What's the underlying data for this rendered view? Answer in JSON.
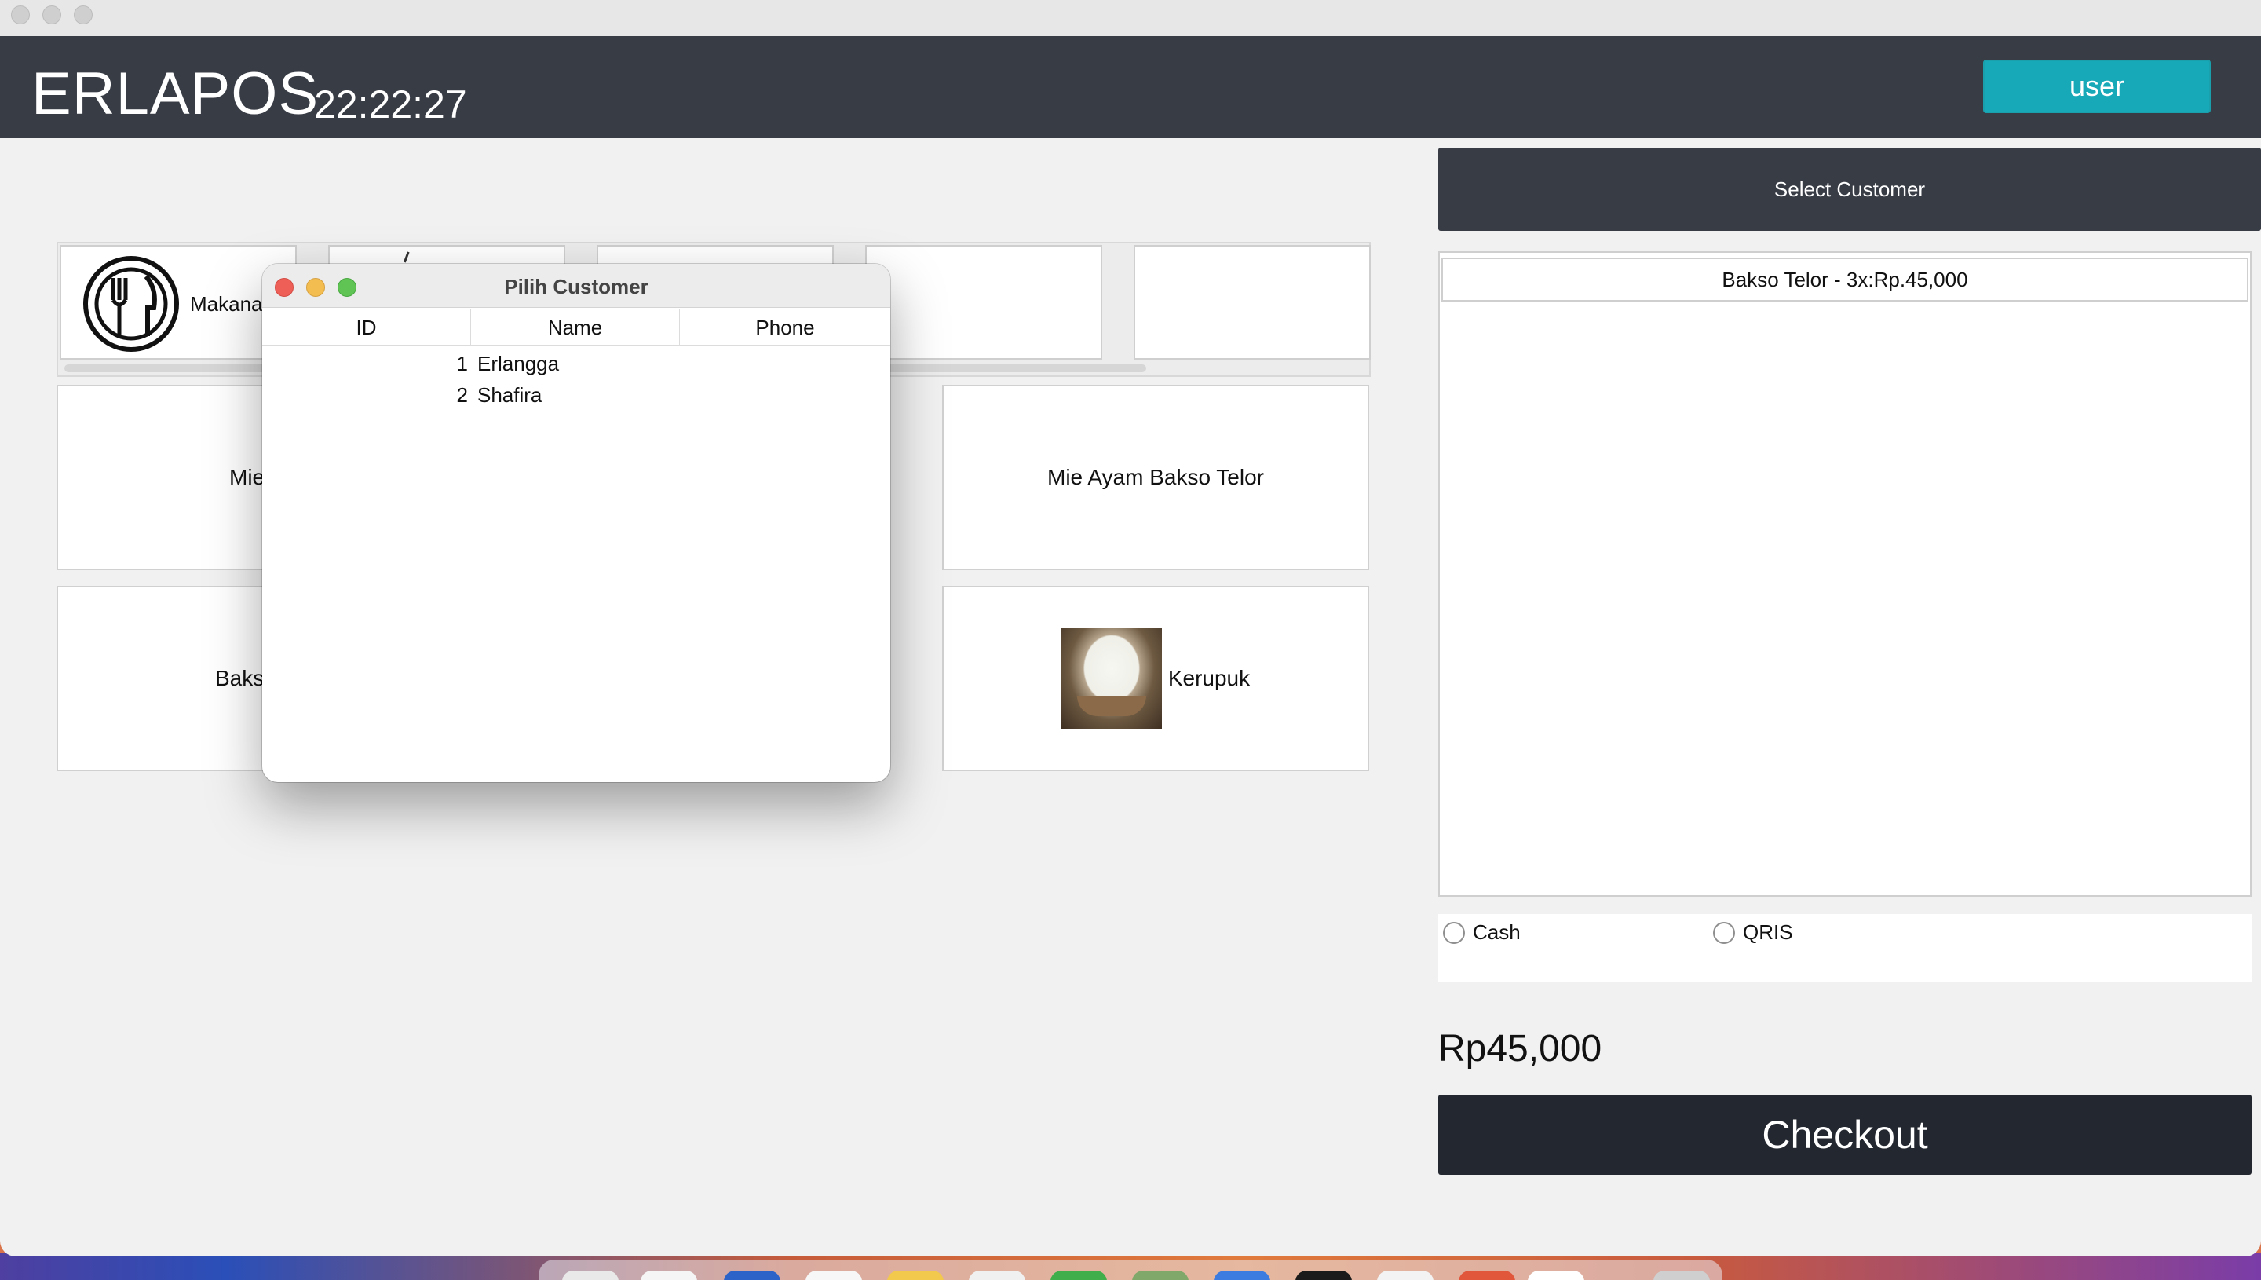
{
  "app": {
    "title": "ERLAPOS",
    "clock": "22:22:27",
    "user_label": "user"
  },
  "categories": [
    {
      "label": "Makanan",
      "icon": "plate-cutlery-icon"
    },
    {
      "label": "",
      "icon": ""
    },
    {
      "label": "",
      "icon": ""
    },
    {
      "label": "",
      "icon": ""
    },
    {
      "label": "",
      "icon": ""
    }
  ],
  "products": [
    {
      "label": "Mie"
    },
    {
      "label": "Mie Ayam Bakso Telor"
    },
    {
      "label": "Baks"
    },
    {
      "label": "Kerupuk",
      "icon": "kerupuk-photo"
    }
  ],
  "right_pane": {
    "select_customer_label": "Select Customer",
    "cart_items": [
      "Bakso Telor - 3x:Rp.45,000"
    ],
    "payment_options": [
      "Cash",
      "QRIS"
    ],
    "total": "Rp45,000",
    "checkout_label": "Checkout"
  },
  "dialog": {
    "title": "Pilih Customer",
    "columns": [
      "ID",
      "Name",
      "Phone"
    ],
    "rows": [
      {
        "id": "1",
        "name": "Erlangga",
        "phone": ""
      },
      {
        "id": "2",
        "name": "Shafira",
        "phone": ""
      }
    ]
  },
  "colors": {
    "header": "#383c45",
    "accent": "#17a9b8",
    "checkout": "#23272f"
  }
}
